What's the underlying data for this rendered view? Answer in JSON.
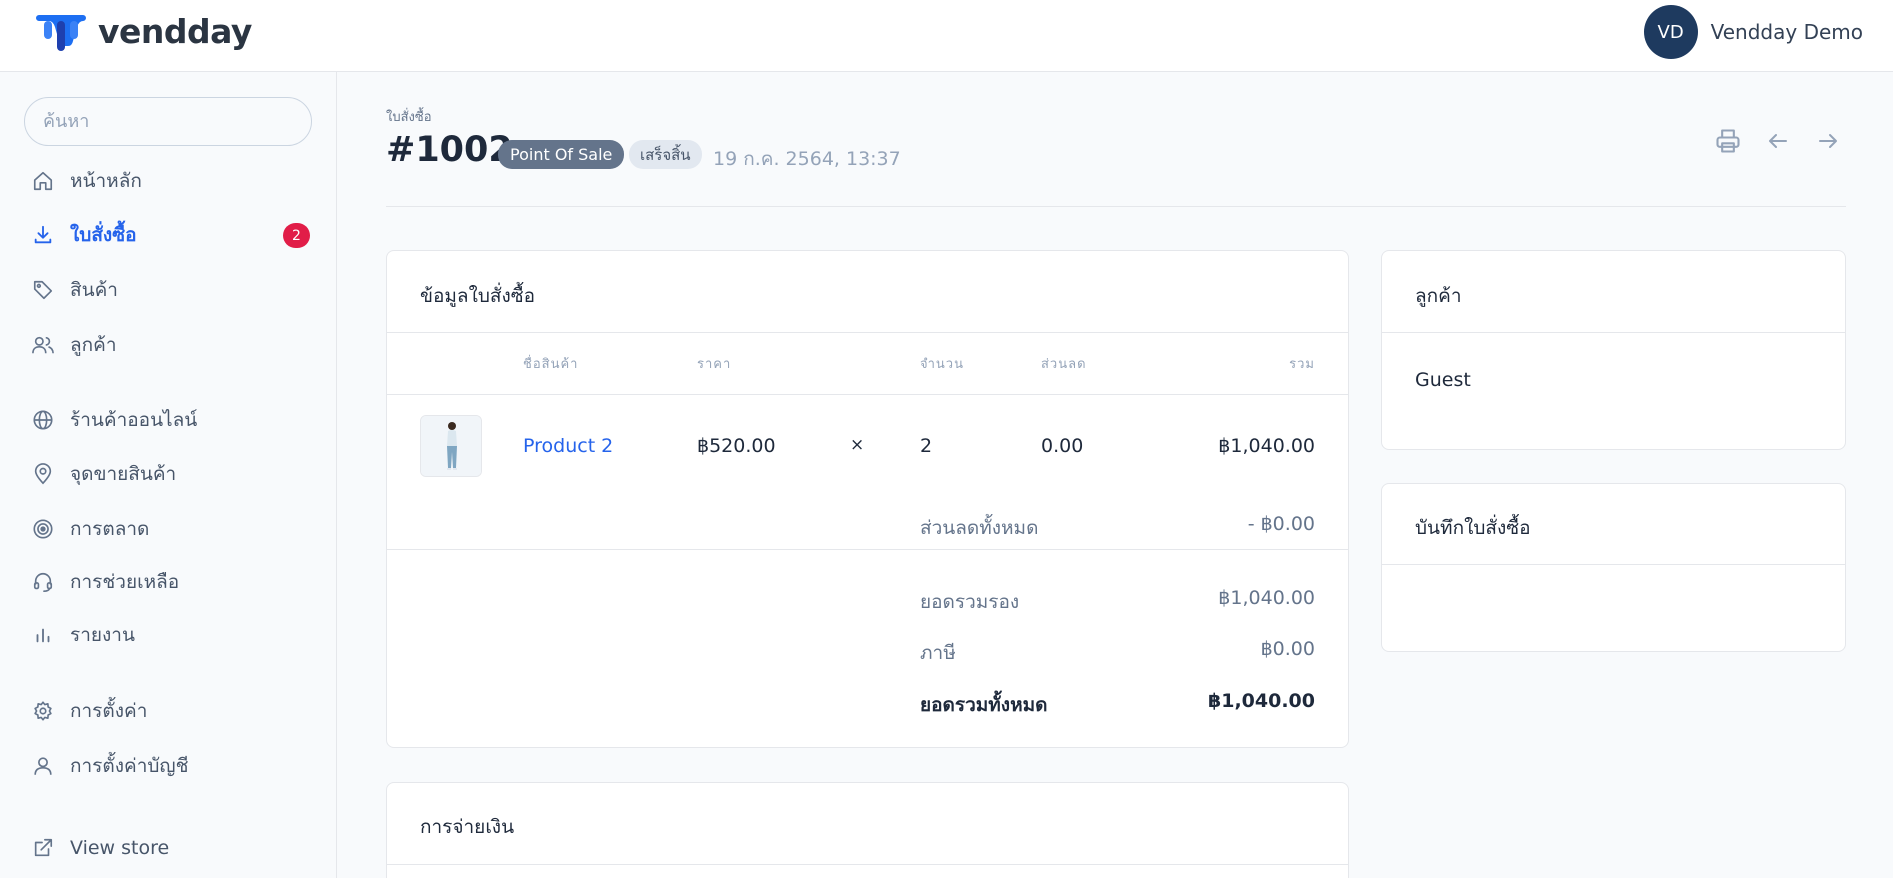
{
  "brand": {
    "name": "vendday"
  },
  "user": {
    "initials": "VD",
    "name": "Vendday Demo"
  },
  "sidebar": {
    "search_placeholder": "ค้นหา",
    "items": [
      {
        "label": "หน้าหลัก",
        "icon": "home-icon"
      },
      {
        "label": "ใบสั่งซื้อ",
        "icon": "download-icon",
        "active": true,
        "badge": "2"
      },
      {
        "label": "สินค้า",
        "icon": "tag-icon"
      },
      {
        "label": "ลูกค้า",
        "icon": "users-icon"
      },
      {
        "label": "ร้านค้าออนไลน์",
        "icon": "globe-icon"
      },
      {
        "label": "จุดขายสินค้า",
        "icon": "map-pin-icon"
      },
      {
        "label": "การตลาด",
        "icon": "target-icon"
      },
      {
        "label": "การช่วยเหลือ",
        "icon": "headset-icon"
      },
      {
        "label": "รายงาน",
        "icon": "bar-chart-icon"
      },
      {
        "label": "การตั้งค่า",
        "icon": "gear-icon"
      },
      {
        "label": "การตั้งค่าบัญชี",
        "icon": "user-icon"
      },
      {
        "label": "View store",
        "icon": "external-link-icon"
      }
    ]
  },
  "order": {
    "breadcrumb": "ใบสั่งซื้อ",
    "number": "#1002",
    "source": "Point Of Sale",
    "status": "เสร็จสิ้น",
    "date": "19 ก.ค. 2564, 13:37"
  },
  "order_info": {
    "title": "ข้อมูลใบสั่งซื้อ",
    "columns": {
      "name": "ชื่อสินค้า",
      "price": "ราคา",
      "qty": "จำนวน",
      "discount": "ส่วนลด",
      "total": "รวม"
    },
    "items": [
      {
        "name": "Product 2",
        "price": "฿520.00",
        "times": "×",
        "qty": "2",
        "discount": "0.00",
        "total": "฿1,040.00"
      }
    ],
    "total_discount_label": "ส่วนลดทั้งหมด",
    "total_discount_value": "- ฿0.00",
    "subtotal_label": "ยอดรวมรอง",
    "subtotal_value": "฿1,040.00",
    "tax_label": "ภาษี",
    "tax_value": "฿0.00",
    "grand_total_label": "ยอดรวมทั้งหมด",
    "grand_total_value": "฿1,040.00"
  },
  "customer": {
    "title": "ลูกค้า",
    "name": "Guest"
  },
  "notes": {
    "title": "บันทึกใบสั่งซื้อ"
  },
  "payment": {
    "title": "การจ่ายเงิน"
  },
  "colors": {
    "accent": "#2563eb",
    "badge": "#e11d48",
    "avatar": "#1e3a5f",
    "logo": "#1d6ff2"
  }
}
